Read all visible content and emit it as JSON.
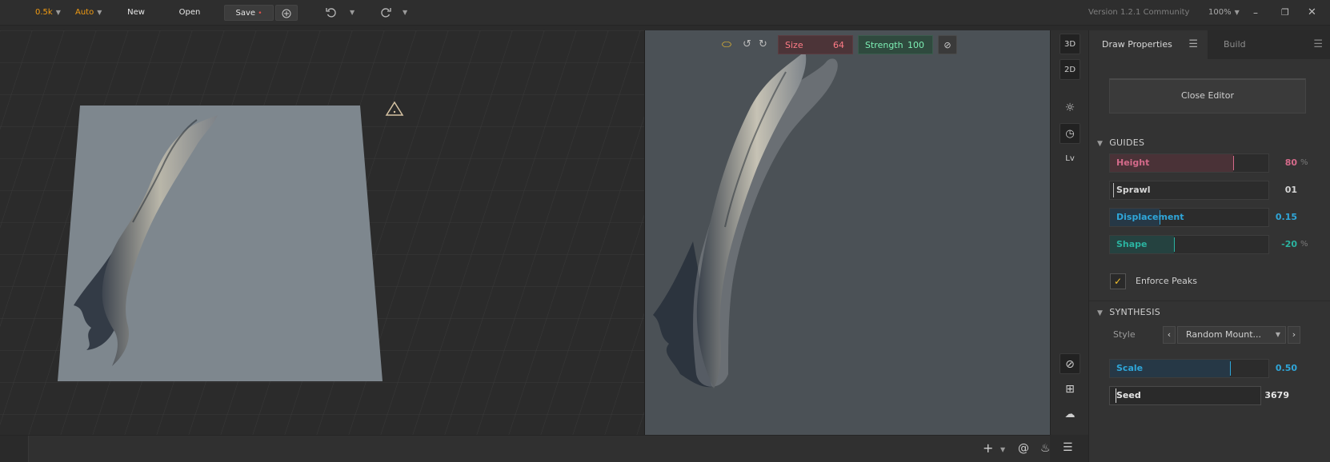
{
  "topbar": {
    "resolution": "0.5k",
    "mode": "Auto",
    "new_label": "New",
    "open_label": "Open",
    "save_label": "Save",
    "save_dirty_marker": "•",
    "version": "Version 1.2.1 Community",
    "zoom": "100%"
  },
  "draw_toolbar": {
    "size_label": "Size",
    "size_value": "64",
    "strength_label": "Strength",
    "strength_value": "100"
  },
  "side_toolbar": {
    "view_3d": "3D",
    "view_2d": "2D",
    "level": "Lv"
  },
  "panel": {
    "tab_active": "Draw Properties",
    "tab_inactive": "Build",
    "close_editor": "Close Editor",
    "guides": {
      "title": "GUIDES",
      "height_label": "Height",
      "height_value": "80",
      "height_unit": "%",
      "sprawl_label": "Sprawl",
      "sprawl_value": "01",
      "displacement_label": "Displacement",
      "displacement_value": "0.15",
      "shape_label": "Shape",
      "shape_value": "-20",
      "shape_unit": "%",
      "enforce_peaks_label": "Enforce Peaks",
      "enforce_peaks_checked": true
    },
    "synthesis": {
      "title": "SYNTHESIS",
      "style_label": "Style",
      "style_value": "Random Mount...",
      "scale_label": "Scale",
      "scale_value": "0.50",
      "seed_label": "Seed",
      "seed_value": "3679"
    }
  },
  "colors": {
    "accent_orange": "#f39c12",
    "height_color": "#d46a8a",
    "displacement_color": "#2fa6d9",
    "shape_color": "#2bb3a0",
    "seed_color": "#e6e6e6"
  }
}
